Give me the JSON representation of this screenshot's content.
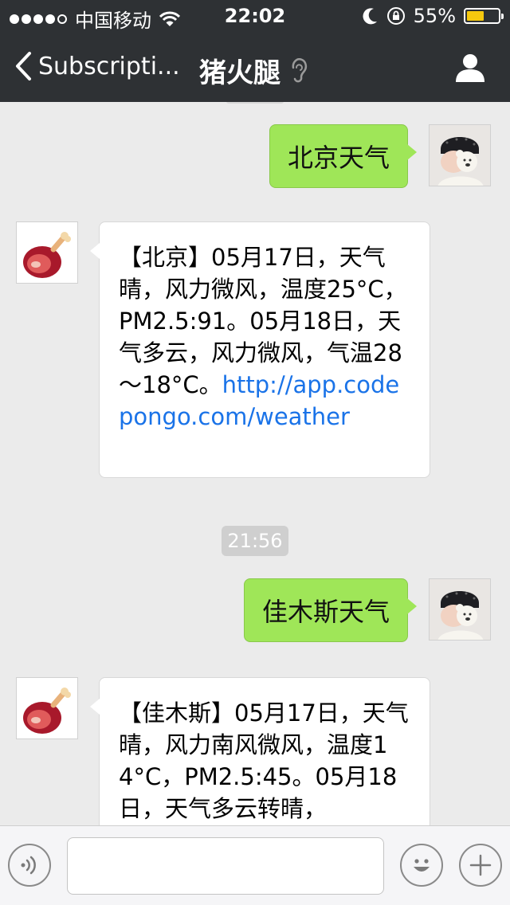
{
  "status_bar": {
    "carrier": "中国移动",
    "time": "22:02",
    "battery_text": "55%",
    "battery_level": 0.55,
    "signal_dots": 5,
    "signal_filled": 4
  },
  "nav": {
    "back_label": "Subscripti...",
    "title": "猪火腿"
  },
  "messages": [
    {
      "side": "out",
      "text": "北京天气"
    },
    {
      "side": "in",
      "text": "【北京】05月17日，天气晴，风力微风，温度25°C，PM2.5:91。05月18日，天气多云，风力微风，气温28～18°C。",
      "link": "http://app.codepongo.com/weather"
    },
    {
      "side": "time",
      "text": "21:56"
    },
    {
      "side": "out",
      "text": "佳木斯天气"
    },
    {
      "side": "in",
      "text": "【佳木斯】05月17日，天气晴，风力南风微风，温度14°C，PM2.5:45。05月18日，天气多云转晴，"
    }
  ],
  "input": {
    "value": "",
    "placeholder": ""
  },
  "colors": {
    "nav_bg": "#2e3134",
    "outgoing_bubble": "#9fe658",
    "link": "#1a73e8",
    "battery": "#f6c90e"
  },
  "icons": [
    "back-chevron-icon",
    "ear-icon",
    "profile-icon",
    "wifi-icon",
    "moon-icon",
    "rotation-lock-icon",
    "voice-icon",
    "emoji-icon",
    "plus-icon"
  ]
}
